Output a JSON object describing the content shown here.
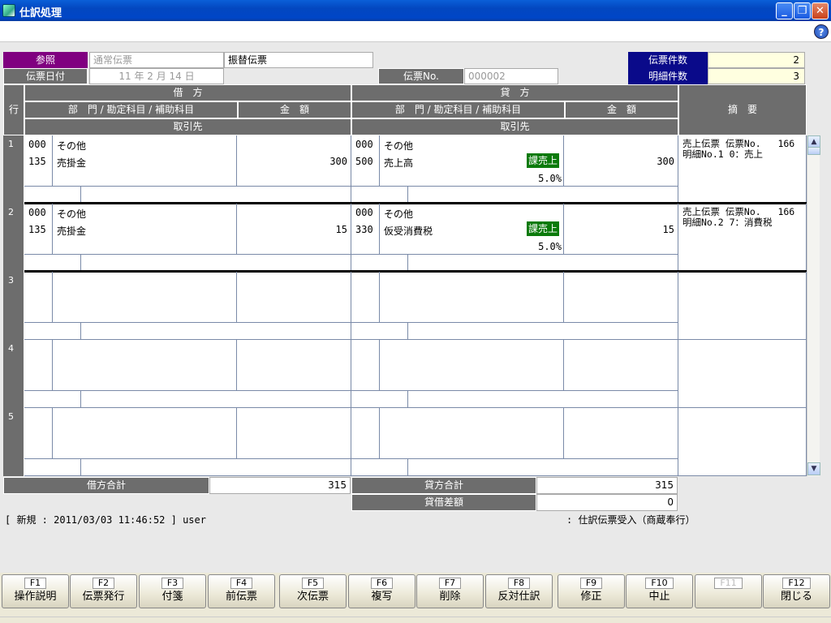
{
  "window": {
    "title": "仕訳処理",
    "minimize": "_",
    "maximize": "❐",
    "close": "✕"
  },
  "help_icon": "?",
  "header": {
    "ref_label": "参照",
    "normal_slip": "通常伝票",
    "transfer_slip": "振替伝票",
    "date_label": "伝票日付",
    "date_value": "11 年  2 月 14 日",
    "slip_no_label": "伝票No.",
    "slip_no_value": "000002",
    "slip_count_label": "伝票件数",
    "slip_count_value": "2",
    "detail_count_label": "明細件数",
    "detail_count_value": "3"
  },
  "grid_headers": {
    "row": "行",
    "debit": "借　方",
    "credit": "貸　方",
    "dept_account": "部　門 / 勘定科目 / 補助科目",
    "amount": "金　額",
    "partner": "取引先",
    "memo": "摘　要"
  },
  "rows": [
    {
      "no": "1",
      "d_dept": "000",
      "d_dept_name": "その他",
      "d_acct": "135",
      "d_acct_name": "売掛金",
      "d_amount": "300",
      "c_dept": "000",
      "c_dept_name": "その他",
      "c_acct": "500",
      "c_acct_name": "売上高",
      "tax": "課売上",
      "rate": "5.0%",
      "c_amount": "300",
      "memo1": "売上伝票 伝票No.   166",
      "memo2": "明細No.1 0：売上"
    },
    {
      "no": "2",
      "d_dept": "000",
      "d_dept_name": "その他",
      "d_acct": "135",
      "d_acct_name": "売掛金",
      "d_amount": "15",
      "c_dept": "000",
      "c_dept_name": "その他",
      "c_acct": "330",
      "c_acct_name": "仮受消費税",
      "tax": "課売上",
      "rate": "5.0%",
      "c_amount": "15",
      "memo1": "売上伝票 伝票No.   166",
      "memo2": "明細No.2 7：消費税"
    },
    {
      "no": "3"
    },
    {
      "no": "4"
    },
    {
      "no": "5"
    }
  ],
  "totals": {
    "debit_label": "借方合計",
    "debit_value": "315",
    "credit_label": "貸方合計",
    "credit_value": "315",
    "diff_label": "貸借差額",
    "diff_value": "0"
  },
  "status": {
    "left": "[ 新規 : 2011/03/03 11:46:52 ] user",
    "right": ": 仕訳伝票受入（商蔵奉行）"
  },
  "fkeys": [
    {
      "key": "F1",
      "label": "操作説明"
    },
    {
      "key": "F2",
      "label": "伝票発行"
    },
    {
      "key": "F3",
      "label": "付箋"
    },
    {
      "key": "F4",
      "label": "前伝票"
    },
    {
      "key": "F5",
      "label": "次伝票"
    },
    {
      "key": "F6",
      "label": "複写"
    },
    {
      "key": "F7",
      "label": "削除"
    },
    {
      "key": "F8",
      "label": "反対仕訳"
    },
    {
      "key": "F9",
      "label": "修正"
    },
    {
      "key": "F10",
      "label": "中止"
    },
    {
      "key": "F11",
      "label": ""
    },
    {
      "key": "F12",
      "label": "閉じる"
    }
  ],
  "colors": {
    "title_bar": "#0046c7",
    "ref_label": "#800080",
    "count_label": "#0a0a8a",
    "tax_badge": "#0b7a0b",
    "header_gray": "#6d6d6d"
  }
}
